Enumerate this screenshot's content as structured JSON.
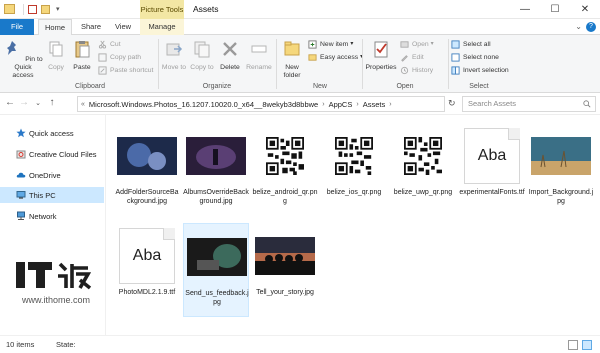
{
  "window": {
    "title": "Assets",
    "context_tab_header": "Picture Tools",
    "controls": {
      "minimize": "—",
      "maximize": "☐",
      "close": "✕"
    }
  },
  "tabs": [
    {
      "label": "File"
    },
    {
      "label": "Home"
    },
    {
      "label": "Share"
    },
    {
      "label": "View"
    },
    {
      "label": "Manage"
    }
  ],
  "ribbon": {
    "clipboard": {
      "group_label": "Clipboard",
      "pin_label": "Pin to Quick access",
      "copy_label": "Copy",
      "paste_label": "Paste",
      "cut_label": "Cut",
      "copy_path_label": "Copy path",
      "paste_shortcut_label": "Paste shortcut"
    },
    "organize": {
      "group_label": "Organize",
      "move_to_label": "Move to",
      "copy_to_label": "Copy to",
      "delete_label": "Delete",
      "rename_label": "Rename"
    },
    "new": {
      "group_label": "New",
      "new_folder_label": "New folder",
      "new_item_label": "New item",
      "easy_access_label": "Easy access"
    },
    "open": {
      "group_label": "Open",
      "properties_label": "Properties",
      "open_label": "Open",
      "edit_label": "Edit",
      "history_label": "History"
    },
    "select": {
      "group_label": "Select",
      "select_all_label": "Select all",
      "select_none_label": "Select none",
      "invert_label": "Invert selection"
    }
  },
  "address": {
    "crumbs": [
      "Microsoft.Windows.Photos_16.1207.10020.0_x64__8wekyb3d8bbwe",
      "AppCS",
      "Assets"
    ],
    "search_placeholder": "Search Assets"
  },
  "sidebar": {
    "items": [
      {
        "label": "Quick access",
        "icon": "star-icon"
      },
      {
        "label": "Creative Cloud Files",
        "icon": "creative-cloud-icon"
      },
      {
        "label": "OneDrive",
        "icon": "cloud-icon"
      },
      {
        "label": "This PC",
        "icon": "computer-icon"
      },
      {
        "label": "Network",
        "icon": "network-icon"
      }
    ]
  },
  "files": [
    {
      "name": "AddFolderSourceBackground.jpg",
      "kind": "photo",
      "colors": [
        "#1d2a4a",
        "#4b6aa8"
      ]
    },
    {
      "name": "AlbumsOverrideBackground.jpg",
      "kind": "photo",
      "colors": [
        "#2a1e3a",
        "#7f5a9c"
      ]
    },
    {
      "name": "belize_android_qr.png",
      "kind": "qr"
    },
    {
      "name": "belize_ios_qr.png",
      "kind": "qr"
    },
    {
      "name": "belize_uwp_qr.png",
      "kind": "qr"
    },
    {
      "name": "experimentalFonts.ttf",
      "kind": "font",
      "font_preview": "Aba"
    },
    {
      "name": "Import_Background.jpg",
      "kind": "photo",
      "colors": [
        "#3a6f86",
        "#c9a46a"
      ]
    },
    {
      "name": "PhotoMDL2.1.9.ttf",
      "kind": "font",
      "font_preview": "Aba"
    },
    {
      "name": "Send_us_feedback.jpg",
      "kind": "photo",
      "colors": [
        "#1a1a1a",
        "#3c6a5c"
      ]
    },
    {
      "name": "Tell_your_story.jpg",
      "kind": "photo",
      "colors": [
        "#2a2c3c",
        "#b56a4a"
      ]
    }
  ],
  "status": {
    "item_count": "10 items",
    "state_label": "State:"
  },
  "watermark": {
    "logo_text": "IT之家",
    "url": "www.ithome.com"
  },
  "colors": {
    "accent": "#1979ca",
    "selection": "#cce8ff",
    "context_tab": "#f3e7a4"
  }
}
